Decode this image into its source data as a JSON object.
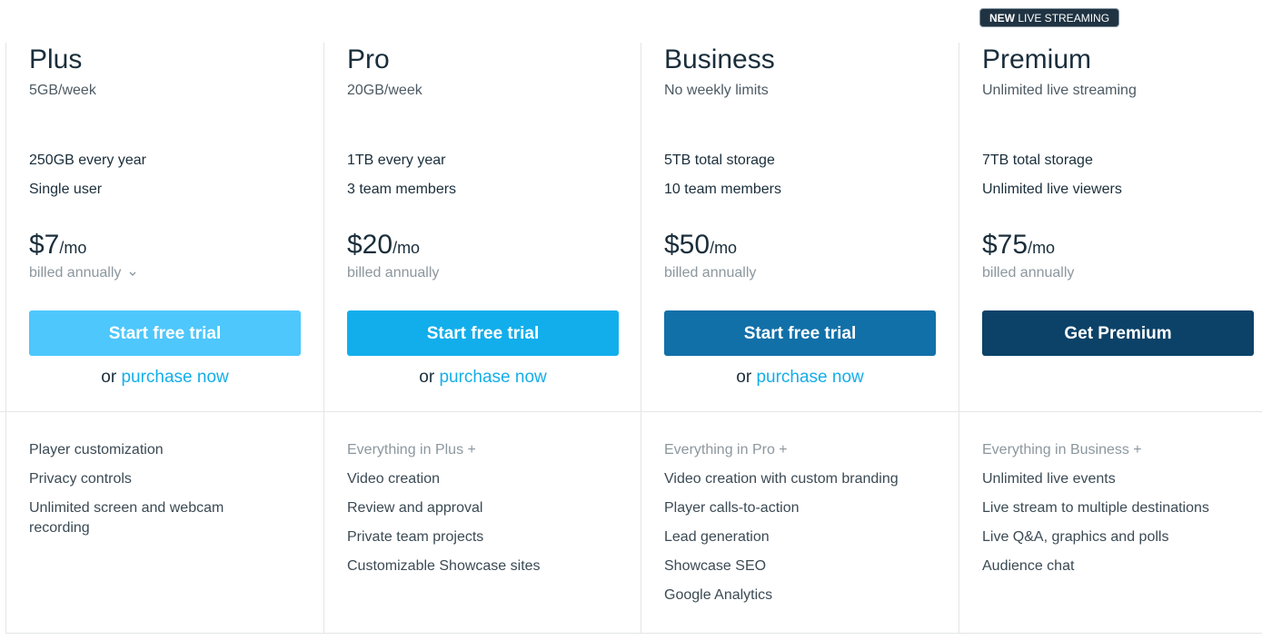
{
  "badge": {
    "bold": "NEW",
    "text": " LIVE STREAMING"
  },
  "plans": [
    {
      "name": "Plus",
      "subtitle": "5GB/week",
      "specs": [
        "250GB every year",
        "Single user"
      ],
      "price": "$7",
      "period": "/mo",
      "billing": "billed annually",
      "has_billing_dropdown": true,
      "cta": "Start free trial",
      "or": "or",
      "purchase": "purchase now",
      "features": [
        "Player customization",
        "Privacy controls",
        "Unlimited screen and webcam recording"
      ]
    },
    {
      "name": "Pro",
      "subtitle": "20GB/week",
      "specs": [
        "1TB every year",
        "3 team members"
      ],
      "price": "$20",
      "period": "/mo",
      "billing": "billed annually",
      "cta": "Start free trial",
      "or": "or",
      "purchase": "purchase now",
      "features_lead": "Everything in Plus +",
      "features": [
        "Video creation",
        "Review and approval",
        "Private team projects",
        "Customizable Showcase sites"
      ]
    },
    {
      "name": "Business",
      "subtitle": "No weekly limits",
      "specs": [
        "5TB total storage",
        "10 team members"
      ],
      "price": "$50",
      "period": "/mo",
      "billing": "billed annually",
      "cta": "Start free trial",
      "or": "or",
      "purchase": "purchase now",
      "features_lead": "Everything in Pro +",
      "features": [
        "Video creation with custom branding",
        "Player calls-to-action",
        "Lead generation",
        "Showcase SEO",
        "Google Analytics"
      ]
    },
    {
      "name": "Premium",
      "subtitle": "Unlimited live streaming",
      "specs": [
        "7TB total storage",
        "Unlimited live viewers"
      ],
      "price": "$75",
      "period": "/mo",
      "billing": "billed annually",
      "cta": "Get Premium",
      "features_lead": "Everything in Business +",
      "features": [
        "Unlimited live events",
        "Live stream to multiple destinations",
        "Live Q&A, graphics and polls",
        "Audience chat"
      ]
    }
  ],
  "colors": {
    "plus_button": "#4ec7fc",
    "pro_button": "#12aeec",
    "business_button": "#1270a8",
    "premium_button": "#0c4268",
    "link": "#14aee9"
  }
}
